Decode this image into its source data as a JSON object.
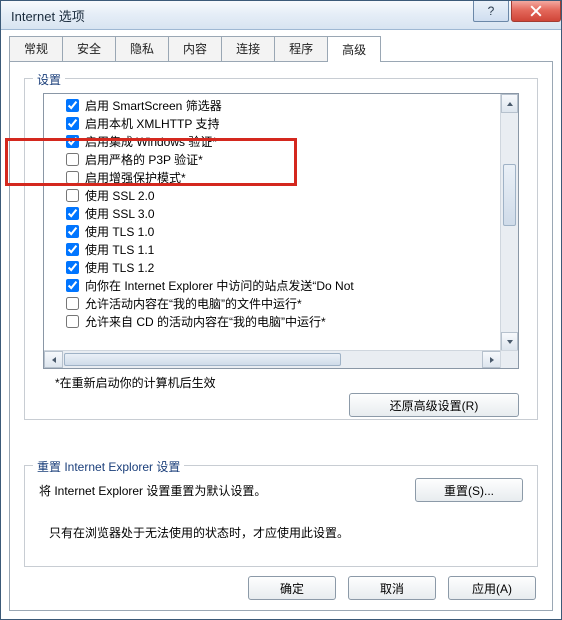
{
  "window": {
    "title": "Internet 选项"
  },
  "tabs": [
    "常规",
    "安全",
    "隐私",
    "内容",
    "连接",
    "程序",
    "高级"
  ],
  "active_tab_index": 6,
  "settings_group": {
    "legend": "设置",
    "restart_note": "*在重新启动你的计算机后生效",
    "restore_button": "还原高级设置(R)",
    "items": [
      {
        "checked": true,
        "label": "启用 SmartScreen 筛选器"
      },
      {
        "checked": true,
        "label": "启用本机 XMLHTTP 支持"
      },
      {
        "checked": true,
        "label": "启用集成 Windows 验证*"
      },
      {
        "checked": false,
        "label": "启用严格的 P3P 验证*"
      },
      {
        "checked": false,
        "label": "启用增强保护模式*"
      },
      {
        "checked": false,
        "label": "使用 SSL 2.0"
      },
      {
        "checked": true,
        "label": "使用 SSL 3.0"
      },
      {
        "checked": true,
        "label": "使用 TLS 1.0"
      },
      {
        "checked": true,
        "label": "使用 TLS 1.1"
      },
      {
        "checked": true,
        "label": "使用 TLS 1.2"
      },
      {
        "checked": true,
        "label": "向你在 Internet Explorer 中访问的站点发送“Do Not"
      },
      {
        "checked": false,
        "label": "允许活动内容在“我的电脑”的文件中运行*"
      },
      {
        "checked": false,
        "label": "允许来自 CD 的活动内容在“我的电脑”中运行*"
      }
    ]
  },
  "reset_group": {
    "legend": "重置 Internet Explorer 设置",
    "desc": "将 Internet Explorer 设置重置为默认设置。",
    "button": "重置(S)...",
    "note": "只有在浏览器处于无法使用的状态时，才应使用此设置。"
  },
  "dialog_buttons": {
    "ok": "确定",
    "cancel": "取消",
    "apply": "应用(A)"
  }
}
